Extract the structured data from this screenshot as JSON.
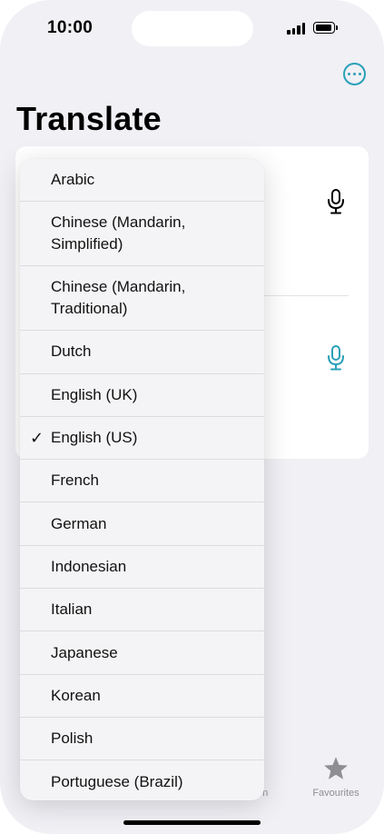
{
  "status_bar": {
    "time": "10:00"
  },
  "header": {
    "title": "Translate",
    "more_icon": "ellipsis-circle-icon"
  },
  "card": {
    "mic_icon": "microphone-icon",
    "mic_top_color": "#000000",
    "mic_bottom_color": "#2aa0b8"
  },
  "language_menu": {
    "selected": "English (US)",
    "items": [
      {
        "label": "Arabic",
        "checked": false
      },
      {
        "label": "Chinese (Mandarin, Simplified)",
        "checked": false
      },
      {
        "label": "Chinese (Mandarin, Traditional)",
        "checked": false
      },
      {
        "label": "Dutch",
        "checked": false
      },
      {
        "label": "English (UK)",
        "checked": false
      },
      {
        "label": "English (US)",
        "checked": true
      },
      {
        "label": "French",
        "checked": false
      },
      {
        "label": "German",
        "checked": false
      },
      {
        "label": "Indonesian",
        "checked": false
      },
      {
        "label": "Italian",
        "checked": false
      },
      {
        "label": "Japanese",
        "checked": false
      },
      {
        "label": "Korean",
        "checked": false
      },
      {
        "label": "Polish",
        "checked": false
      },
      {
        "label": "Portuguese (Brazil)",
        "checked": false
      }
    ],
    "checkmark": "✓"
  },
  "tab_bar": {
    "partial_label": "on",
    "favourites_label": "Favourites",
    "favourites_icon": "star-icon"
  },
  "colors": {
    "accent": "#2aa0b8",
    "background": "#f0f0f5"
  }
}
